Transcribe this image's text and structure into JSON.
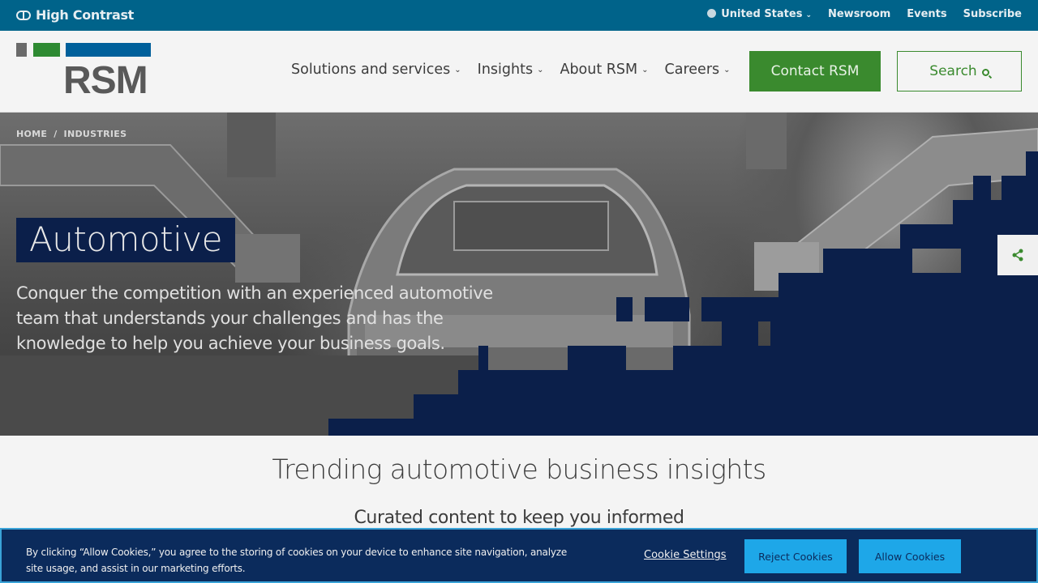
{
  "utility": {
    "high_contrast": "High Contrast",
    "region": "United States",
    "links": [
      "Newsroom",
      "Events",
      "Subscribe"
    ]
  },
  "header": {
    "logo_text": "RSM",
    "nav": [
      "Solutions and services",
      "Insights",
      "About RSM",
      "Careers"
    ],
    "contact_label": "Contact RSM",
    "search_label": "Search"
  },
  "hero": {
    "breadcrumb": [
      "HOME",
      "/",
      "INDUSTRIES"
    ],
    "title": "Automotive",
    "subtitle": "Conquer the competition with an experienced automotive team that understands your challenges and has the knowledge to help you achieve your business goals."
  },
  "content": {
    "heading": "Trending automotive business insights",
    "subheading": "Curated content to keep you informed"
  },
  "cookie": {
    "text": "By clicking “Allow Cookies,” you agree to the storing of cookies on your device to enhance site navigation, analyze site usage, and assist in our marketing efforts.",
    "settings_label": "Cookie Settings",
    "reject_label": "Reject Cookies",
    "allow_label": "Allow Cookies"
  },
  "colors": {
    "utility_bar": "#00638a",
    "brand_green": "#3a8a2e",
    "brand_navy": "#0b1f4a",
    "cookie_bg": "#0b2b5c",
    "cookie_button": "#1ea7e8"
  },
  "icons": [
    "high-contrast-icon",
    "globe-icon",
    "chevron-down-icon",
    "search-icon",
    "share-icon"
  ]
}
